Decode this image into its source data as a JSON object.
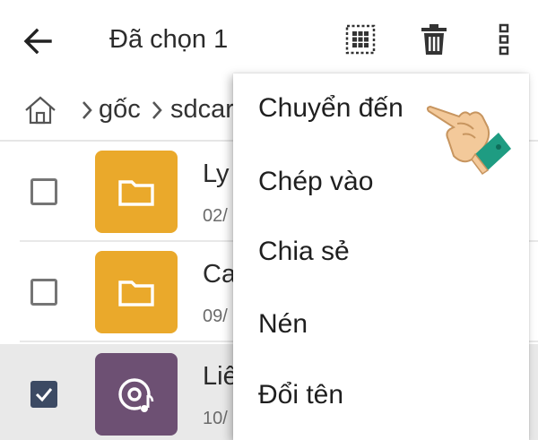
{
  "header": {
    "title": "Đã chọn 1"
  },
  "breadcrumb": {
    "segments": [
      "gốc",
      "sdcard"
    ]
  },
  "files": [
    {
      "name": "Ly",
      "date": "02/",
      "type": "folder",
      "checked": false
    },
    {
      "name": "Ca",
      "date": "09/",
      "type": "folder",
      "checked": false
    },
    {
      "name": "Liê",
      "date": "10/",
      "type": "music",
      "checked": true
    }
  ],
  "menu": {
    "items": [
      "Chuyển đến",
      "Chép vào",
      "Chia sẻ",
      "Nén",
      "Đổi tên"
    ]
  },
  "colors": {
    "folder": "#eaa92b",
    "music": "#6d5073",
    "checkbox_checked": "#3c4a63",
    "selected_row": "#e9e9e9"
  }
}
